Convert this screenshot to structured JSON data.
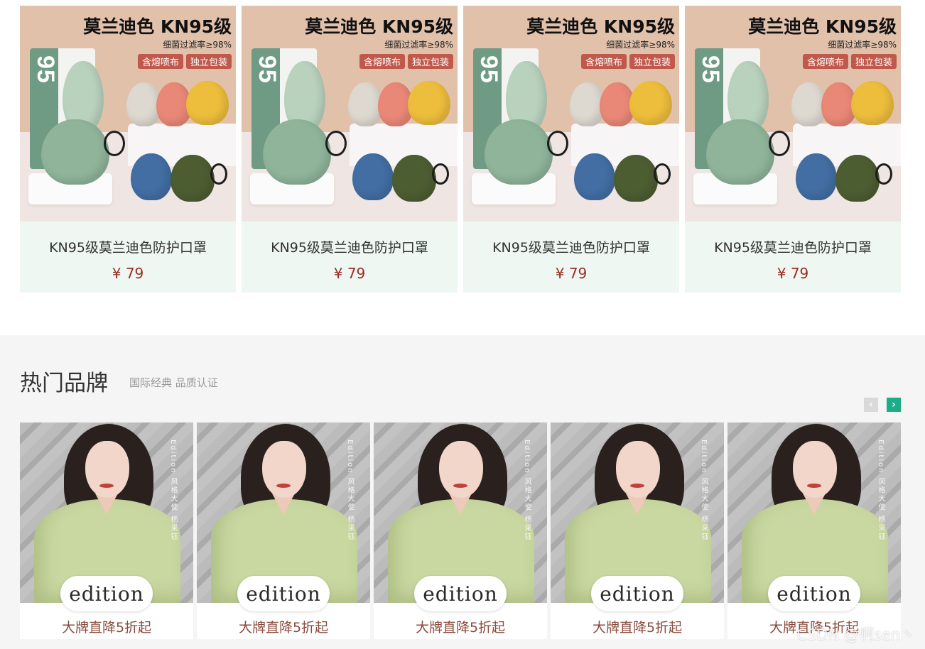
{
  "products": [
    {
      "headline": "莫兰迪色 KN95级",
      "subline": "细菌过滤率≥98%",
      "tags": [
        "含熔喷布",
        "独立包装"
      ],
      "package_mark": "95",
      "name": "KN95级莫兰迪色防护口罩",
      "price": "¥ 79"
    },
    {
      "headline": "莫兰迪色 KN95级",
      "subline": "细菌过滤率≥98%",
      "tags": [
        "含熔喷布",
        "独立包装"
      ],
      "package_mark": "95",
      "name": "KN95级莫兰迪色防护口罩",
      "price": "¥ 79"
    },
    {
      "headline": "莫兰迪色 KN95级",
      "subline": "细菌过滤率≥98%",
      "tags": [
        "含熔喷布",
        "独立包装"
      ],
      "package_mark": "95",
      "name": "KN95级莫兰迪色防护口罩",
      "price": "¥ 79"
    },
    {
      "headline": "莫兰迪色 KN95级",
      "subline": "细菌过滤率≥98%",
      "tags": [
        "含熔喷布",
        "独立包装"
      ],
      "package_mark": "95",
      "name": "KN95级莫兰迪色防护口罩",
      "price": "¥ 79"
    }
  ],
  "brand_section": {
    "title": "热门品牌",
    "subtitle": "国际经典 品质认证",
    "prev_icon": "chevron-left-icon",
    "next_icon": "chevron-right-icon",
    "cards": [
      {
        "logo": "edition",
        "vertical_text": "Edition 风格大使 杨采钰",
        "caption": "大牌直降5折起"
      },
      {
        "logo": "edition",
        "vertical_text": "Edition 风格大使 杨采钰",
        "caption": "大牌直降5折起"
      },
      {
        "logo": "edition",
        "vertical_text": "Edition 风格大使 杨采钰",
        "caption": "大牌直降5折起"
      },
      {
        "logo": "edition",
        "vertical_text": "Edition 风格大使 杨采钰",
        "caption": "大牌直降5折起"
      },
      {
        "logo": "edition",
        "vertical_text": "Edition 风格大使 杨采钰",
        "caption": "大牌直降5折起"
      }
    ]
  },
  "watermark": "CSDN @啊sen丶",
  "colors": {
    "product_bg": "#eef7f2",
    "price": "#9a2d23",
    "tag": "#c0594b",
    "accent": "#1aad86",
    "caption": "#8a4a3c"
  }
}
